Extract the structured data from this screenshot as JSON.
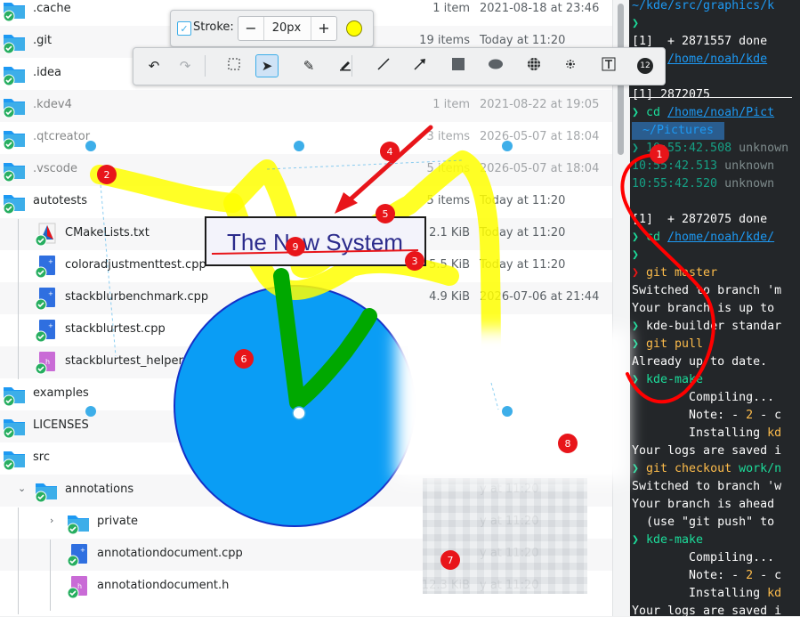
{
  "files": [
    {
      "name": ".cache",
      "size": "1 item",
      "date": "2021-08-18 at 23:46",
      "type": "folder",
      "faded": false
    },
    {
      "name": ".git",
      "size": "19 items",
      "date": "Today at 11:20",
      "type": "folder",
      "faded": false
    },
    {
      "name": ".idea",
      "size": "",
      "date": "",
      "type": "folder",
      "faded": false
    },
    {
      "name": ".kdev4",
      "size": "1 item",
      "date": "2021-08-22 at 19:05",
      "type": "folder",
      "faded": true
    },
    {
      "name": ".qtcreator",
      "size": "3 items",
      "date": "2026-05-07 at 18:04",
      "type": "folder",
      "faded": true
    },
    {
      "name": ".vscode",
      "size": "5 items",
      "date": "2026-05-07 at 18:04",
      "type": "folder",
      "faded": true
    },
    {
      "name": "autotests",
      "size": "5 items",
      "date": "Today at 11:20",
      "type": "folder",
      "faded": false
    },
    {
      "name": "CMakeLists.txt",
      "size": "2.1 KiB",
      "date": "Today at 11:20",
      "type": "cmake",
      "faded": false
    },
    {
      "name": "coloradjustmenttest.cpp",
      "size": "5.5 KiB",
      "date": "Today at 11:20",
      "type": "cpp",
      "faded": false
    },
    {
      "name": "stackblurbenchmark.cpp",
      "size": "4.9 KiB",
      "date": "2026-07-06 at 21:44",
      "type": "cpp",
      "faded": false
    },
    {
      "name": "stackblurtest.cpp",
      "size": "",
      "date": "",
      "type": "cpp",
      "faded": false
    },
    {
      "name": "stackblurtest_helpers",
      "size": "",
      "date": "",
      "type": "h",
      "faded": false
    },
    {
      "name": "examples",
      "size": "",
      "date": "",
      "type": "folder",
      "faded": false
    },
    {
      "name": "LICENSES",
      "size": "",
      "date": "",
      "type": "folder",
      "faded": false
    },
    {
      "name": "src",
      "size": "",
      "date": "",
      "type": "folder",
      "faded": false
    },
    {
      "name": "annotations",
      "size": "",
      "date": "y at 11:20",
      "type": "folder",
      "faded": false
    },
    {
      "name": "private",
      "size": "",
      "date": "y at 11:20",
      "type": "folder",
      "faded": false
    },
    {
      "name": "annotationdocument.cpp",
      "size": "",
      "date": "y at 11:20",
      "type": "cpp",
      "faded": false
    },
    {
      "name": "annotationdocument.h",
      "size": "12.3 KiB",
      "date": "y at 11:20",
      "type": "h",
      "faded": false
    }
  ],
  "terminal": {
    "lines": [
      {
        "parts": [
          {
            "t": "~/kde/src/graphics/k",
            "c": "t-blue"
          }
        ]
      },
      {
        "parts": [
          {
            "t": "❯",
            "c": "t-green"
          }
        ]
      },
      {
        "parts": [
          {
            "t": "[1]  + 2871557 done",
            "c": ""
          }
        ]
      },
      {
        "parts": [
          {
            "t": "❯ ",
            "c": "t-green"
          },
          {
            "t": "cd ",
            "c": "t-green"
          },
          {
            "t": "/home/noah/kde",
            "c": "t-blue t-u"
          }
        ]
      },
      {
        "parts": [
          {
            "t": "❯ &",
            "c": "t-green"
          }
        ]
      },
      {
        "parts": [
          {
            "t": "[1] 2872075",
            "c": ""
          }
        ]
      },
      {
        "parts": [
          {
            "t": "❯ ",
            "c": "t-green"
          },
          {
            "t": "cd ",
            "c": "t-green"
          },
          {
            "t": "/home/noah/Pict",
            "c": "t-blue t-u"
          }
        ]
      },
      {
        "parts": [
          {
            "t": " ~/Pictures ",
            "c": "t-blue"
          }
        ]
      },
      {
        "parts": [
          {
            "t": "❯ 10:55:42.508 ",
            "c": "t-teal"
          },
          {
            "t": "unknown",
            "c": "t-dim"
          }
        ]
      },
      {
        "parts": [
          {
            "t": "10:55:42.513 ",
            "c": "t-teal"
          },
          {
            "t": "unknown",
            "c": "t-dim"
          }
        ]
      },
      {
        "parts": [
          {
            "t": "10:55:42.520 ",
            "c": "t-teal"
          },
          {
            "t": "unknown",
            "c": "t-dim"
          }
        ]
      },
      {
        "parts": [
          {
            "t": "",
            "c": ""
          }
        ]
      },
      {
        "parts": [
          {
            "t": "[1]  + 2872075 done",
            "c": ""
          }
        ]
      },
      {
        "parts": [
          {
            "t": "❯ ",
            "c": "t-green"
          },
          {
            "t": "cd ",
            "c": "t-green"
          },
          {
            "t": "/home/noah/kde/",
            "c": "t-blue t-u"
          }
        ]
      },
      {
        "parts": [
          {
            "t": "❯ ",
            "c": "t-green"
          }
        ]
      },
      {
        "parts": [
          {
            "t": "❯ ",
            "c": "t-red"
          },
          {
            "t": "git master",
            "c": "t-yellow"
          }
        ]
      },
      {
        "parts": [
          {
            "t": "Switched to branch 'm",
            "c": ""
          }
        ]
      },
      {
        "parts": [
          {
            "t": "Your branch is up to",
            "c": ""
          }
        ]
      },
      {
        "parts": [
          {
            "t": "❯ ",
            "c": "t-green"
          },
          {
            "t": "kde-builder standar",
            "c": ""
          }
        ]
      },
      {
        "parts": [
          {
            "t": "❯ ",
            "c": "t-green"
          },
          {
            "t": "git pull",
            "c": "t-yellow"
          }
        ]
      },
      {
        "parts": [
          {
            "t": "Already up to date.",
            "c": ""
          }
        ]
      },
      {
        "parts": [
          {
            "t": "❯ ",
            "c": "t-green"
          },
          {
            "t": "kde-make",
            "c": "t-green"
          }
        ]
      },
      {
        "parts": [
          {
            "t": "        Compiling...",
            "c": ""
          }
        ]
      },
      {
        "parts": [
          {
            "t": "        Note: - ",
            "c": ""
          },
          {
            "t": "2",
            "c": "t-yellow"
          },
          {
            "t": " - c",
            "c": ""
          }
        ]
      },
      {
        "parts": [
          {
            "t": "        Installing ",
            "c": ""
          },
          {
            "t": "kd",
            "c": "t-yellow"
          }
        ]
      },
      {
        "parts": [
          {
            "t": "Your logs are saved i",
            "c": ""
          }
        ]
      },
      {
        "parts": [
          {
            "t": "❯ ",
            "c": "t-green"
          },
          {
            "t": "git checkout ",
            "c": "t-yellow"
          },
          {
            "t": "work/n",
            "c": "t-green"
          }
        ]
      },
      {
        "parts": [
          {
            "t": "Switched to branch 'w",
            "c": ""
          }
        ]
      },
      {
        "parts": [
          {
            "t": "Your branch is ahead",
            "c": ""
          }
        ]
      },
      {
        "parts": [
          {
            "t": "  (use \"git push\" to",
            "c": ""
          }
        ]
      },
      {
        "parts": [
          {
            "t": "❯ ",
            "c": "t-green"
          },
          {
            "t": "kde-make",
            "c": "t-green"
          }
        ]
      },
      {
        "parts": [
          {
            "t": "        Compiling...",
            "c": ""
          }
        ]
      },
      {
        "parts": [
          {
            "t": "        Note: - ",
            "c": ""
          },
          {
            "t": "2",
            "c": "t-yellow"
          },
          {
            "t": " - c",
            "c": ""
          }
        ]
      },
      {
        "parts": [
          {
            "t": "        Installing ",
            "c": ""
          },
          {
            "t": "kd",
            "c": "t-yellow"
          }
        ]
      },
      {
        "parts": [
          {
            "t": "Your logs are saved i",
            "c": ""
          }
        ]
      }
    ]
  },
  "toolbar_top": {
    "stroke_label": "Stroke:",
    "stroke_checked": true,
    "minus": "−",
    "value": "20px",
    "plus": "+",
    "color": "#ffff00"
  },
  "toolbar_main": {
    "tools": [
      {
        "id": "undo",
        "icon": "undo-icon",
        "glyph": "↶"
      },
      {
        "id": "redo",
        "icon": "redo-icon",
        "glyph": "↷"
      },
      {
        "id": "select-region",
        "icon": "select-region-icon",
        "glyph": ""
      },
      {
        "id": "pointer",
        "icon": "pointer-icon",
        "glyph": "➤"
      },
      {
        "id": "freehand",
        "icon": "freehand-icon",
        "glyph": "✎"
      },
      {
        "id": "highlighter",
        "icon": "highlighter-icon",
        "glyph": ""
      },
      {
        "id": "line",
        "icon": "line-icon",
        "glyph": ""
      },
      {
        "id": "arrow",
        "icon": "arrow-icon",
        "glyph": ""
      },
      {
        "id": "rectangle",
        "icon": "rectangle-icon",
        "glyph": ""
      },
      {
        "id": "ellipse",
        "icon": "ellipse-icon",
        "glyph": ""
      },
      {
        "id": "pixelate",
        "icon": "pixelate-icon",
        "glyph": ""
      },
      {
        "id": "blur",
        "icon": "blur-icon",
        "glyph": ""
      },
      {
        "id": "text",
        "icon": "text-icon",
        "glyph": ""
      },
      {
        "id": "number",
        "icon": "number-stamp-icon",
        "glyph": "12"
      }
    ]
  },
  "annotations": {
    "text_box": "The New System",
    "number_labels": [
      "1",
      "2",
      "3",
      "4",
      "5",
      "6",
      "7",
      "8",
      "9"
    ],
    "colors": {
      "yellow": "#ffff00",
      "green": "#00a800",
      "red": "#ff0000",
      "blue_fill": "#0a9df5",
      "blue_stroke": "#1430c8",
      "handle": "#3daee9"
    }
  }
}
